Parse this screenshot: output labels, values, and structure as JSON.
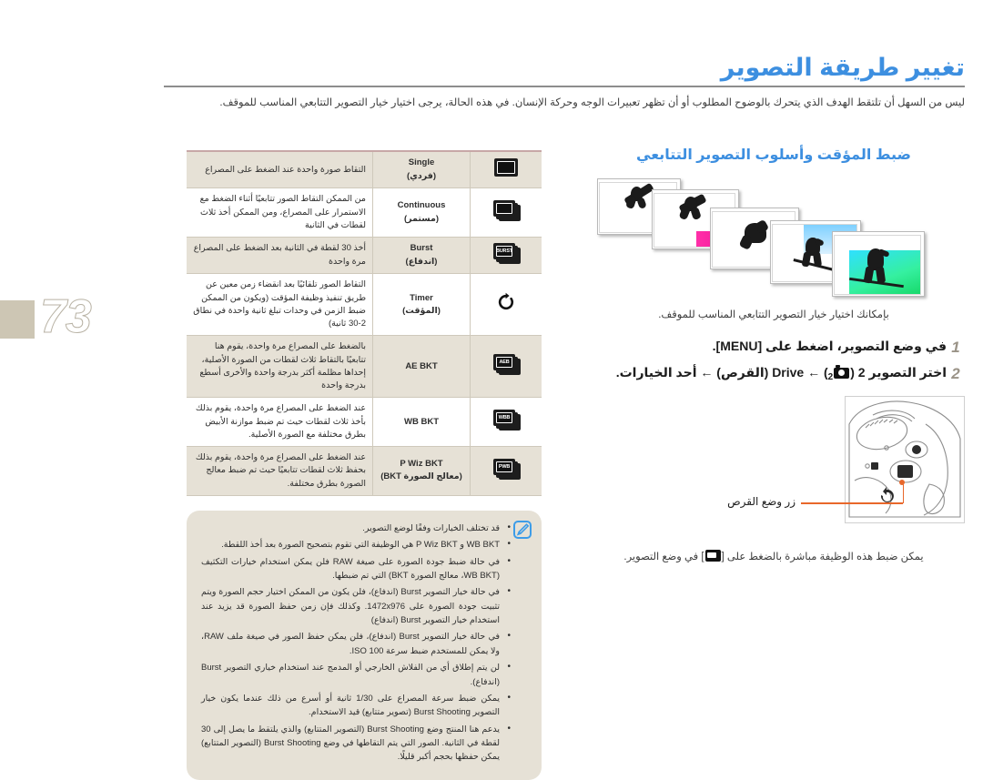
{
  "page": {
    "number": "73",
    "title": "تغيير طريقة التصوير",
    "intro": "ليس من السهل أن تلتقط الهدف الذي يتحرك بالوضوح المطلوب أو أن تظهر تعبيرات الوجه وحركة الإنسان. في هذه الحالة، يرجى اختيار خيار التصوير التتابعي المناسب للموقف."
  },
  "section": {
    "heading": "ضبط المؤقت وأسلوب التصوير التتابعي",
    "lead": "بإمكانك اختيار خيار التصوير التتابعي المناسب للموقف.",
    "steps": [
      {
        "num": "1",
        "text": "في وضع التصوير، اضغط على [MENU]."
      },
      {
        "num": "2",
        "text_before": "اختر التصوير ",
        "bold_2": "2",
        "cam_sub": "2",
        "text_after": " (",
        "drive_label": "Drive",
        "arabic_drive": "(القرص)",
        "arrow": "←",
        "text_end": "أحد الخيارات."
      }
    ],
    "step2_full": "اختر التصوير 2 (الكاميرا2) ← Drive (القرص) ← أحد الخيارات.",
    "callout_label": "زر وضع القرص",
    "tip": "يمكن ضبط هذه الوظيفة مباشرة بالضغط على [شاشة] في وضع التصوير."
  },
  "table": {
    "rows": [
      {
        "icon": "single-frame-icon",
        "name_en": "Single",
        "name_ar": "(فردي)",
        "desc": "التقاط صورة واحدة عند الضغط على المصراع"
      },
      {
        "icon": "continuous-frames-icon",
        "name_en": "Continuous",
        "name_ar": "(مستمر)",
        "desc": "من الممكن التقاط الصور تتابعيًا أثناء الضغط مع الاستمرار على المصراع، ومن الممكن أخذ ثلاث لقطات في الثانية"
      },
      {
        "icon": "burst-icon",
        "name_en": "Burst",
        "name_ar": "(اندفاع)",
        "desc": "أخذ 30 لقطة في الثانية بعد الضغط على المصراع مرة واحدة"
      },
      {
        "icon": "timer-icon",
        "name_en": "Timer",
        "name_ar": "(المؤقت)",
        "desc": "التقاط الصور تلقائيًا بعد انقضاء زمن معين عن طريق تنفيذ وظيفة المؤقت (ويكون من الممكن ضبط الزمن في وحدات تبلغ ثانية واحدة في نطاق 2-30 ثانية)"
      },
      {
        "icon": "aeb-icon",
        "name_en": "AE BKT",
        "name_ar": "",
        "desc": "بالضغط على المصراع مرة واحدة، يقوم هنا تتابعيًا بالتقاط ثلاث لقطات من الصورة الأصلية، إحداها مظلمة أكثر بدرجة واحدة والأخرى أسطع بدرجة واحدة"
      },
      {
        "icon": "wbb-icon",
        "name_en": "WB BKT",
        "name_ar": "",
        "desc": "عند الضغط على المصراع مرة واحدة، يقوم بذلك بأخذ ثلاث لقطات حيث تم ضبط موازنة الأبيض بطرق مختلفة مع الصورة الأصلية."
      },
      {
        "icon": "pwb-icon",
        "name_en": "P Wiz BKT",
        "name_ar": "(معالج الصورة BKT)",
        "desc": "عند الضغط على المصراع مرة واحدة، يقوم بذلك بحفظ ثلاث لقطات تتابعيًا حيث تم ضبط معالج الصورة بطرق مختلفة."
      }
    ]
  },
  "notes": {
    "icon": "note-pencil-icon",
    "items": [
      "قد تختلف الخيارات وفقًا لوضع التصوير.",
      "WB BKT و P Wiz BKT هي الوظيفة التي تقوم بتصحيح الصورة بعد أخذ اللقطة.",
      "في حالة ضبط جودة الصورة على صيغة RAW فلن يمكن استخدام خيارات التكثيف (WB BKT، معالج الصورة BKT) التي تم ضبطها.",
      "في حالة خيار التصوير Burst (اندفاع)، فلن يكون من الممكن اختيار حجم الصورة ويتم تثبيت جودة الصورة على 1472x976. وكذلك فإن زمن حفظ الصورة قد يزيد عند استخدام خيار التصوير Burst (اندفاع)",
      "في حالة خيار التصوير Burst (اندفاع)، فلن يمكن حفظ الصور في صيغة ملف RAW، ولا يمكن للمستخدم ضبط سرعة ISO 100.",
      "لن يتم إطلاق أي من الفلاش الخارجي أو المدمج عند استخدام خياري التصوير Burst (اندفاع).",
      "يمكن ضبط سرعة المصراع على 1/30 ثانية أو أسرع من ذلك عندما يكون خيار التصوير Burst Shooting (تصوير متتابع) قيد الاستخدام.",
      "يدعم هنا المنتج وضع Burst Shooting (التصوير المتتابع) والذي يلتقط ما يصل إلى 30 لقطة في الثانية. الصور التي يتم التقاطها في وضع Burst Shooting (التصوير المتتابع) يمكن حفظها بحجم أكبر قليلًا."
    ]
  },
  "colors": {
    "accent_blue": "#3d8fe0",
    "callout_orange": "#e8672a",
    "table_shade": "#e6e1d6",
    "table_top_border": "#c7a7a7",
    "page_tab": "#cdc6b4"
  }
}
